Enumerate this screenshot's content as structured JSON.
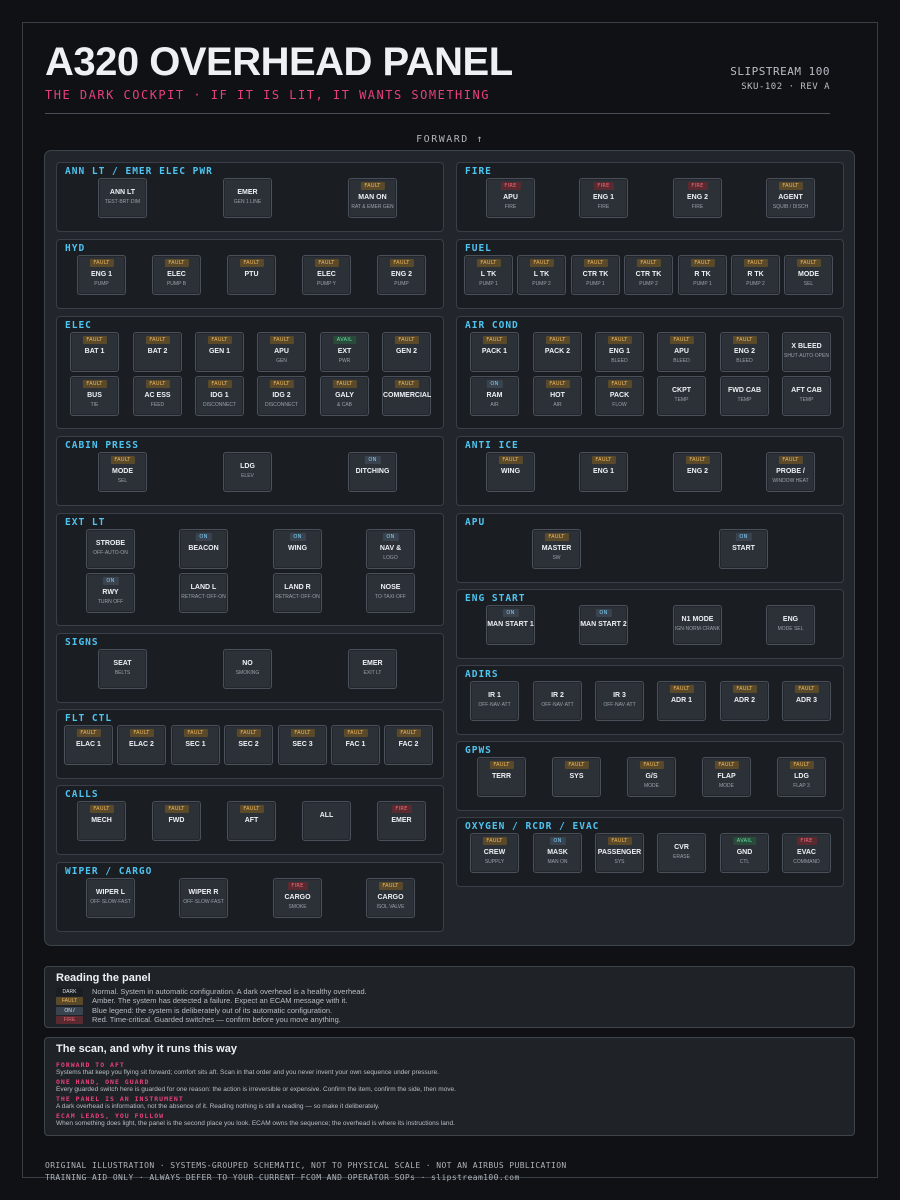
{
  "header": {
    "title": "A320 OVERHEAD PANEL",
    "subtitle": "THE DARK COCKPIT · IF IT IS LIT, IT WANTS SOMETHING",
    "brand": "SLIPSTREAM 100",
    "sku": "SKU-102 · REV A",
    "forward": "FORWARD ↑"
  },
  "colors": {
    "accent_cyan": "#4ec4f0",
    "accent_pink": "#e8407a",
    "fault": "#f0b860",
    "fire": "#f06a78",
    "avail": "#60e0a0",
    "on": "#7fd0f8"
  },
  "sections": {
    "ann_lt": {
      "label": "ANN LT / EMER ELEC PWR",
      "buttons": [
        {
          "legend": "",
          "name": "ANN LT",
          "sub": "TEST·BRT·DIM"
        },
        {
          "legend": "",
          "name": "EMER",
          "sub": "GEN 1 LINE"
        },
        {
          "legend": "FAULT",
          "name": "MAN ON",
          "sub": "RAT & EMER GEN"
        }
      ]
    },
    "hyd": {
      "label": "HYD",
      "buttons": [
        {
          "legend": "FAULT",
          "name": "ENG 1",
          "sub": "PUMP"
        },
        {
          "legend": "FAULT",
          "name": "ELEC",
          "sub": "PUMP B"
        },
        {
          "legend": "FAULT",
          "name": "PTU",
          "sub": ""
        },
        {
          "legend": "FAULT",
          "name": "ELEC",
          "sub": "PUMP Y"
        },
        {
          "legend": "FAULT",
          "name": "ENG 2",
          "sub": "PUMP"
        }
      ]
    },
    "elec": {
      "label": "ELEC",
      "buttons": [
        {
          "legend": "FAULT",
          "name": "BAT 1",
          "sub": ""
        },
        {
          "legend": "FAULT",
          "name": "BAT 2",
          "sub": ""
        },
        {
          "legend": "FAULT",
          "name": "GEN 1",
          "sub": ""
        },
        {
          "legend": "FAULT",
          "name": "APU",
          "sub": "GEN"
        },
        {
          "legend": "AVAIL",
          "name": "EXT",
          "sub": "PWR"
        },
        {
          "legend": "FAULT",
          "name": "GEN 2",
          "sub": ""
        },
        {
          "legend": "FAULT",
          "name": "BUS",
          "sub": "TIE"
        },
        {
          "legend": "FAULT",
          "name": "AC ESS",
          "sub": "FEED"
        },
        {
          "legend": "FAULT",
          "name": "IDG 1",
          "sub": "DISCONNECT"
        },
        {
          "legend": "FAULT",
          "name": "IDG 2",
          "sub": "DISCONNECT"
        },
        {
          "legend": "FAULT",
          "name": "GALY",
          "sub": "& CAB"
        },
        {
          "legend": "FAULT",
          "name": "COMMERCIAL",
          "sub": ""
        }
      ]
    },
    "cabin_press": {
      "label": "CABIN PRESS",
      "buttons": [
        {
          "legend": "FAULT",
          "name": "MODE",
          "sub": "SEL"
        },
        {
          "legend": "",
          "name": "LDG",
          "sub": "ELEV"
        },
        {
          "legend": "ON",
          "name": "DITCHING",
          "sub": ""
        }
      ]
    },
    "ext_lt": {
      "label": "EXT LT",
      "buttons": [
        {
          "legend": "",
          "name": "STROBE",
          "sub": "OFF·AUTO·ON"
        },
        {
          "legend": "ON",
          "name": "BEACON",
          "sub": ""
        },
        {
          "legend": "ON",
          "name": "WING",
          "sub": ""
        },
        {
          "legend": "ON",
          "name": "NAV &",
          "sub": "LOGO"
        },
        {
          "legend": "ON",
          "name": "RWY",
          "sub": "TURN OFF"
        },
        {
          "legend": "",
          "name": "LAND L",
          "sub": "RETRACT·OFF·ON"
        },
        {
          "legend": "",
          "name": "LAND R",
          "sub": "RETRACT·OFF·ON"
        },
        {
          "legend": "",
          "name": "NOSE",
          "sub": "TO·TAXI·OFF"
        }
      ]
    },
    "signs": {
      "label": "SIGNS",
      "buttons": [
        {
          "legend": "",
          "name": "SEAT",
          "sub": "BELTS"
        },
        {
          "legend": "",
          "name": "NO",
          "sub": "SMOKING"
        },
        {
          "legend": "",
          "name": "EMER",
          "sub": "EXIT LT"
        }
      ]
    },
    "flt_ctl": {
      "label": "FLT CTL",
      "buttons": [
        {
          "legend": "FAULT",
          "name": "ELAC 1",
          "sub": ""
        },
        {
          "legend": "FAULT",
          "name": "ELAC 2",
          "sub": ""
        },
        {
          "legend": "FAULT",
          "name": "SEC 1",
          "sub": ""
        },
        {
          "legend": "FAULT",
          "name": "SEC 2",
          "sub": ""
        },
        {
          "legend": "FAULT",
          "name": "SEC 3",
          "sub": ""
        },
        {
          "legend": "FAULT",
          "name": "FAC 1",
          "sub": ""
        },
        {
          "legend": "FAULT",
          "name": "FAC 2",
          "sub": ""
        }
      ]
    },
    "calls": {
      "label": "CALLS",
      "buttons": [
        {
          "legend": "FAULT",
          "name": "MECH",
          "sub": ""
        },
        {
          "legend": "FAULT",
          "name": "FWD",
          "sub": ""
        },
        {
          "legend": "FAULT",
          "name": "AFT",
          "sub": ""
        },
        {
          "legend": "",
          "name": "ALL",
          "sub": ""
        },
        {
          "legend": "FIRE",
          "name": "EMER",
          "sub": ""
        }
      ]
    },
    "wiper_cargo": {
      "label": "WIPER / CARGO",
      "buttons": [
        {
          "legend": "",
          "name": "WIPER L",
          "sub": "OFF·SLOW·FAST"
        },
        {
          "legend": "",
          "name": "WIPER R",
          "sub": "OFF·SLOW·FAST"
        },
        {
          "legend": "FIRE",
          "name": "CARGO",
          "sub": "SMOKE"
        },
        {
          "legend": "FAULT",
          "name": "CARGO",
          "sub": "ISOL VALVE"
        }
      ]
    },
    "fire": {
      "label": "FIRE",
      "buttons": [
        {
          "legend": "FIRE",
          "name": "APU",
          "sub": "FIRE"
        },
        {
          "legend": "FIRE",
          "name": "ENG 1",
          "sub": "FIRE"
        },
        {
          "legend": "FIRE",
          "name": "ENG 2",
          "sub": "FIRE"
        },
        {
          "legend": "FAULT",
          "name": "AGENT",
          "sub": "SQUIB / DISCH"
        }
      ]
    },
    "fuel": {
      "label": "FUEL",
      "buttons": [
        {
          "legend": "FAULT",
          "name": "L TK",
          "sub": "PUMP 1"
        },
        {
          "legend": "FAULT",
          "name": "L TK",
          "sub": "PUMP 2"
        },
        {
          "legend": "FAULT",
          "name": "CTR TK",
          "sub": "PUMP 1"
        },
        {
          "legend": "FAULT",
          "name": "CTR TK",
          "sub": "PUMP 2"
        },
        {
          "legend": "FAULT",
          "name": "R TK",
          "sub": "PUMP 1"
        },
        {
          "legend": "FAULT",
          "name": "R TK",
          "sub": "PUMP 2"
        },
        {
          "legend": "FAULT",
          "name": "MODE",
          "sub": "SEL"
        }
      ]
    },
    "air_cond": {
      "label": "AIR COND",
      "buttons": [
        {
          "legend": "FAULT",
          "name": "PACK 1",
          "sub": ""
        },
        {
          "legend": "FAULT",
          "name": "PACK 2",
          "sub": ""
        },
        {
          "legend": "FAULT",
          "name": "ENG 1",
          "sub": "BLEED"
        },
        {
          "legend": "FAULT",
          "name": "APU",
          "sub": "BLEED"
        },
        {
          "legend": "FAULT",
          "name": "ENG 2",
          "sub": "BLEED"
        },
        {
          "legend": "",
          "name": "X BLEED",
          "sub": "SHUT·AUTO·OPEN"
        },
        {
          "legend": "ON",
          "name": "RAM",
          "sub": "AIR"
        },
        {
          "legend": "FAULT",
          "name": "HOT",
          "sub": "AIR"
        },
        {
          "legend": "FAULT",
          "name": "PACK",
          "sub": "FLOW"
        },
        {
          "legend": "",
          "name": "CKPT",
          "sub": "TEMP"
        },
        {
          "legend": "",
          "name": "FWD CAB",
          "sub": "TEMP"
        },
        {
          "legend": "",
          "name": "AFT CAB",
          "sub": "TEMP"
        }
      ]
    },
    "anti_ice": {
      "label": "ANTI ICE",
      "buttons": [
        {
          "legend": "FAULT",
          "name": "WING",
          "sub": ""
        },
        {
          "legend": "FAULT",
          "name": "ENG 1",
          "sub": ""
        },
        {
          "legend": "FAULT",
          "name": "ENG 2",
          "sub": ""
        },
        {
          "legend": "FAULT",
          "name": "PROBE /",
          "sub": "WINDOW HEAT"
        }
      ]
    },
    "apu": {
      "label": "APU",
      "buttons": [
        {
          "legend": "FAULT",
          "name": "MASTER",
          "sub": "SW"
        },
        {
          "legend": "ON",
          "name": "START",
          "sub": ""
        }
      ]
    },
    "eng_start": {
      "label": "ENG START",
      "buttons": [
        {
          "legend": "ON",
          "name": "MAN START 1",
          "sub": ""
        },
        {
          "legend": "ON",
          "name": "MAN START 2",
          "sub": ""
        },
        {
          "legend": "",
          "name": "N1 MODE",
          "sub": "IGN·NORM·CRANK"
        },
        {
          "legend": "",
          "name": "ENG",
          "sub": "MODE SEL"
        }
      ]
    },
    "adirs": {
      "label": "ADIRS",
      "buttons": [
        {
          "legend": "",
          "name": "IR 1",
          "sub": "OFF·NAV·ATT"
        },
        {
          "legend": "",
          "name": "IR 2",
          "sub": "OFF·NAV·ATT"
        },
        {
          "legend": "",
          "name": "IR 3",
          "sub": "OFF·NAV·ATT"
        },
        {
          "legend": "FAULT",
          "name": "ADR 1",
          "sub": ""
        },
        {
          "legend": "FAULT",
          "name": "ADR 2",
          "sub": ""
        },
        {
          "legend": "FAULT",
          "name": "ADR 3",
          "sub": ""
        }
      ]
    },
    "gpws": {
      "label": "GPWS",
      "buttons": [
        {
          "legend": "FAULT",
          "name": "TERR",
          "sub": ""
        },
        {
          "legend": "FAULT",
          "name": "SYS",
          "sub": ""
        },
        {
          "legend": "FAULT",
          "name": "G/S",
          "sub": "MODE"
        },
        {
          "legend": "FAULT",
          "name": "FLAP",
          "sub": "MODE"
        },
        {
          "legend": "FAULT",
          "name": "LDG",
          "sub": "FLAP 3"
        }
      ]
    },
    "oxygen": {
      "label": "OXYGEN / RCDR / EVAC",
      "buttons": [
        {
          "legend": "FAULT",
          "name": "CREW",
          "sub": "SUPPLY"
        },
        {
          "legend": "ON",
          "name": "MASK",
          "sub": "MAN ON"
        },
        {
          "legend": "FAULT",
          "name": "PASSENGER",
          "sub": "SYS"
        },
        {
          "legend": "",
          "name": "CVR",
          "sub": "ERASE"
        },
        {
          "legend": "AVAIL",
          "name": "GND",
          "sub": "CTL"
        },
        {
          "legend": "FIRE",
          "name": "EVAC",
          "sub": "COMMAND"
        }
      ]
    }
  },
  "legend": {
    "title": "Reading the panel",
    "rows": [
      {
        "chip": "DARK",
        "text": "Normal. System in automatic configuration. A dark overhead is a healthy overhead."
      },
      {
        "chip": "FAULT",
        "text": "Amber. The system has detected a failure. Expect an ECAM message with it."
      },
      {
        "chip": "ON /",
        "text": "Blue legend: the system is deliberately out of its automatic configuration."
      },
      {
        "chip": "FIRE",
        "text": "Red. Time-critical. Guarded switches — confirm before you move anything."
      }
    ]
  },
  "scan": {
    "title": "The scan, and why it runs this way",
    "items": [
      {
        "head": "FORWARD TO AFT",
        "body": "Systems that keep you flying sit forward; comfort sits aft. Scan in that order and you never invent your own sequence under pressure."
      },
      {
        "head": "ONE HAND, ONE GUARD",
        "body": "Every guarded switch here is guarded for one reason: the action is irreversible or expensive. Confirm the item, confirm the side, then move."
      },
      {
        "head": "THE PANEL IS AN INSTRUMENT",
        "body": "A dark overhead is information, not the absence of it. Reading nothing is still a reading — so make it deliberately."
      },
      {
        "head": "ECAM LEADS, YOU FOLLOW",
        "body": "When something does light, the panel is the second place you look. ECAM owns the sequence; the overhead is where its instructions land."
      }
    ]
  },
  "footer": {
    "line1": "ORIGINAL ILLUSTRATION · SYSTEMS-GROUPED SCHEMATIC, NOT TO PHYSICAL SCALE · NOT AN AIRBUS PUBLICATION",
    "line2": "TRAINING AID ONLY · ALWAYS DEFER TO YOUR CURRENT FCOM AND OPERATOR SOPs · slipstream100.com"
  }
}
